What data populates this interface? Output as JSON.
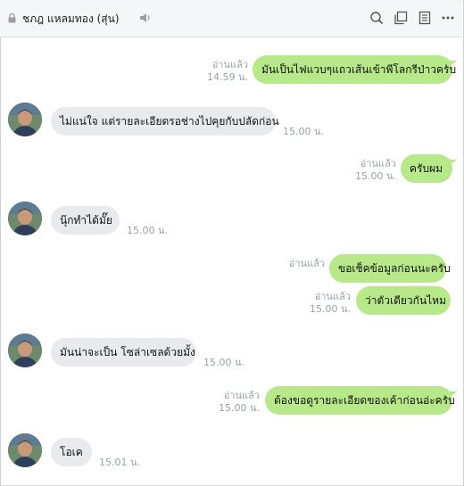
{
  "chat": {
    "title": "ชภฎ แหลมทอง (สุ่น)"
  },
  "messages": [
    {
      "dir": "out",
      "text": "มันเป็นไฟแวบๆแถวเส้นเข้าพีโลกรีป่าวครับ",
      "read": "อ่านแล้ว",
      "time": "14.59 น."
    },
    {
      "dir": "in",
      "text": "ไม่แน่ใจ แต่รายละเอียดรอช่างไปคุยกับปลัดก่อน",
      "time": "15.00 น."
    },
    {
      "dir": "out",
      "text": "ครับผม",
      "read": "อ่านแล้ว",
      "time": "15.00 น."
    },
    {
      "dir": "in",
      "text": "นุ๊กทำได้มั๊ย",
      "time": "15.00 น."
    },
    {
      "dir": "out",
      "text": "ขอเช็คข้อมูลก่อนนะครับ",
      "read": "อ่านแล้ว",
      "time": ""
    },
    {
      "dir": "out",
      "text": "ว่าตัวเดียวกันไหม",
      "read": "อ่านแล้ว",
      "time": "15.00 น."
    },
    {
      "dir": "in",
      "text": "มันน่าจะเป็น โซล่าเซลด้วยมั้ง",
      "time": "15.00 น."
    },
    {
      "dir": "out",
      "text": "ต้องขอดูรายละเอียดของเค้าก่อนอ่ะครับ",
      "read": "อ่านแล้ว",
      "time": "15.00 น."
    },
    {
      "dir": "in",
      "text": "โอเค",
      "time": "15.01 น."
    }
  ]
}
